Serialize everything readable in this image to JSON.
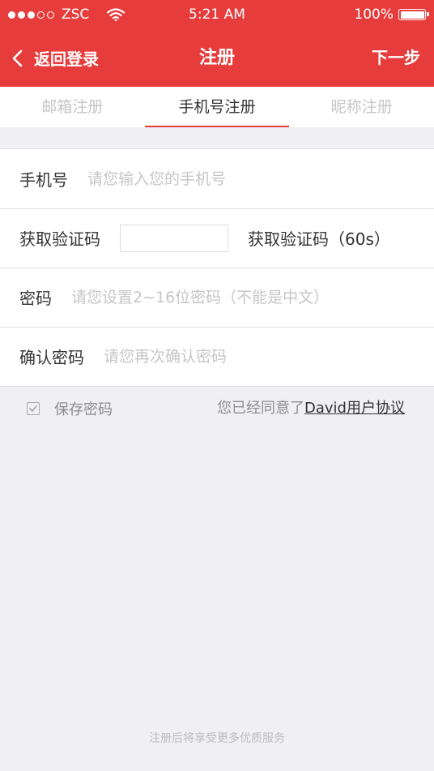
{
  "status_bar": {
    "carrier": "ZSC",
    "time": "5:21 AM",
    "battery": "100%",
    "signal_dots_filled": 3,
    "signal_dots_total": 5
  },
  "nav": {
    "back_label": "返回登录",
    "title": "注册",
    "next_label": "下一步"
  },
  "tabs": [
    {
      "label": "邮箱注册",
      "active": false
    },
    {
      "label": "手机号注册",
      "active": true
    },
    {
      "label": "昵称注册",
      "active": false
    }
  ],
  "form": {
    "phone": {
      "label": "手机号",
      "placeholder": "请您输入您的手机号",
      "value": ""
    },
    "code": {
      "label": "获取验证码",
      "value": "",
      "button_label": "获取验证码（60s）"
    },
    "password": {
      "label": "密码",
      "placeholder": "请您设置2~16位密码（不能是中文）",
      "value": ""
    },
    "confirm": {
      "label": "确认密码",
      "placeholder": "请您再次确认密码",
      "value": ""
    }
  },
  "options": {
    "save_password_label": "保存密码",
    "agree_prefix": "您已经同意了",
    "agreement_link": "David用户协议"
  },
  "footer_note": "注册后将享受更多优质服务",
  "colors": {
    "accent": "#e63c3c",
    "background": "#efeff4",
    "placeholder": "#c6c6c6"
  },
  "icons": {
    "back": "chevron-left-icon",
    "wifi": "wifi-icon",
    "battery": "battery-icon",
    "checkbox": "check-icon"
  }
}
